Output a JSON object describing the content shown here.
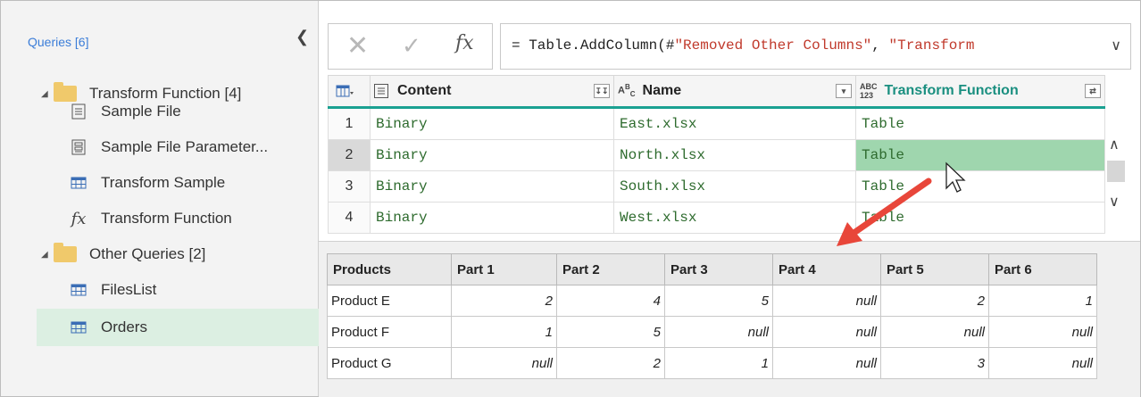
{
  "sidebar": {
    "title": "Queries [6]",
    "groups": [
      {
        "label": "Transform Function [4]",
        "items": [
          {
            "label": "Sample File",
            "icon": "document-icon"
          },
          {
            "label": "Sample File Parameter...",
            "icon": "parameter-icon"
          },
          {
            "label": "Transform Sample",
            "icon": "table-icon"
          },
          {
            "label": "Transform Function",
            "icon": "fx-icon"
          }
        ]
      },
      {
        "label": "Other Queries [2]",
        "items": [
          {
            "label": "FilesList",
            "icon": "table-icon"
          },
          {
            "label": "Orders",
            "icon": "table-icon",
            "selected": true
          }
        ]
      }
    ]
  },
  "formula_bar": {
    "prefix": "= Table.AddColumn(#",
    "string1": "\"Removed Other Columns\"",
    "middle": ", ",
    "string2": "\"Transform",
    "fx": "fx"
  },
  "grid": {
    "columns": [
      {
        "label": "Content",
        "type": "binary"
      },
      {
        "label": "Name",
        "type_label": "ABC"
      },
      {
        "label": "Transform Function",
        "type_label": "ABC 123"
      }
    ],
    "rows": [
      {
        "n": "1",
        "content": "Binary",
        "name": "East.xlsx",
        "tf": "Table"
      },
      {
        "n": "2",
        "content": "Binary",
        "name": "North.xlsx",
        "tf": "Table"
      },
      {
        "n": "3",
        "content": "Binary",
        "name": "South.xlsx",
        "tf": "Table"
      },
      {
        "n": "4",
        "content": "Binary",
        "name": "West.xlsx",
        "tf": "Table"
      }
    ]
  },
  "preview": {
    "headers": [
      "Products",
      "Part 1",
      "Part 2",
      "Part 3",
      "Part 4",
      "Part 5",
      "Part 6"
    ],
    "rows": [
      [
        "Product E",
        "2",
        "4",
        "5",
        "null",
        "2",
        "1"
      ],
      [
        "Product F",
        "1",
        "5",
        "null",
        "null",
        "null",
        "null"
      ],
      [
        "Product G",
        "null",
        "2",
        "1",
        "null",
        "3",
        "null"
      ]
    ]
  },
  "colors": {
    "accent": "#1aa191",
    "selected_cell": "#9fd6ae",
    "arrow": "#e8463a"
  }
}
